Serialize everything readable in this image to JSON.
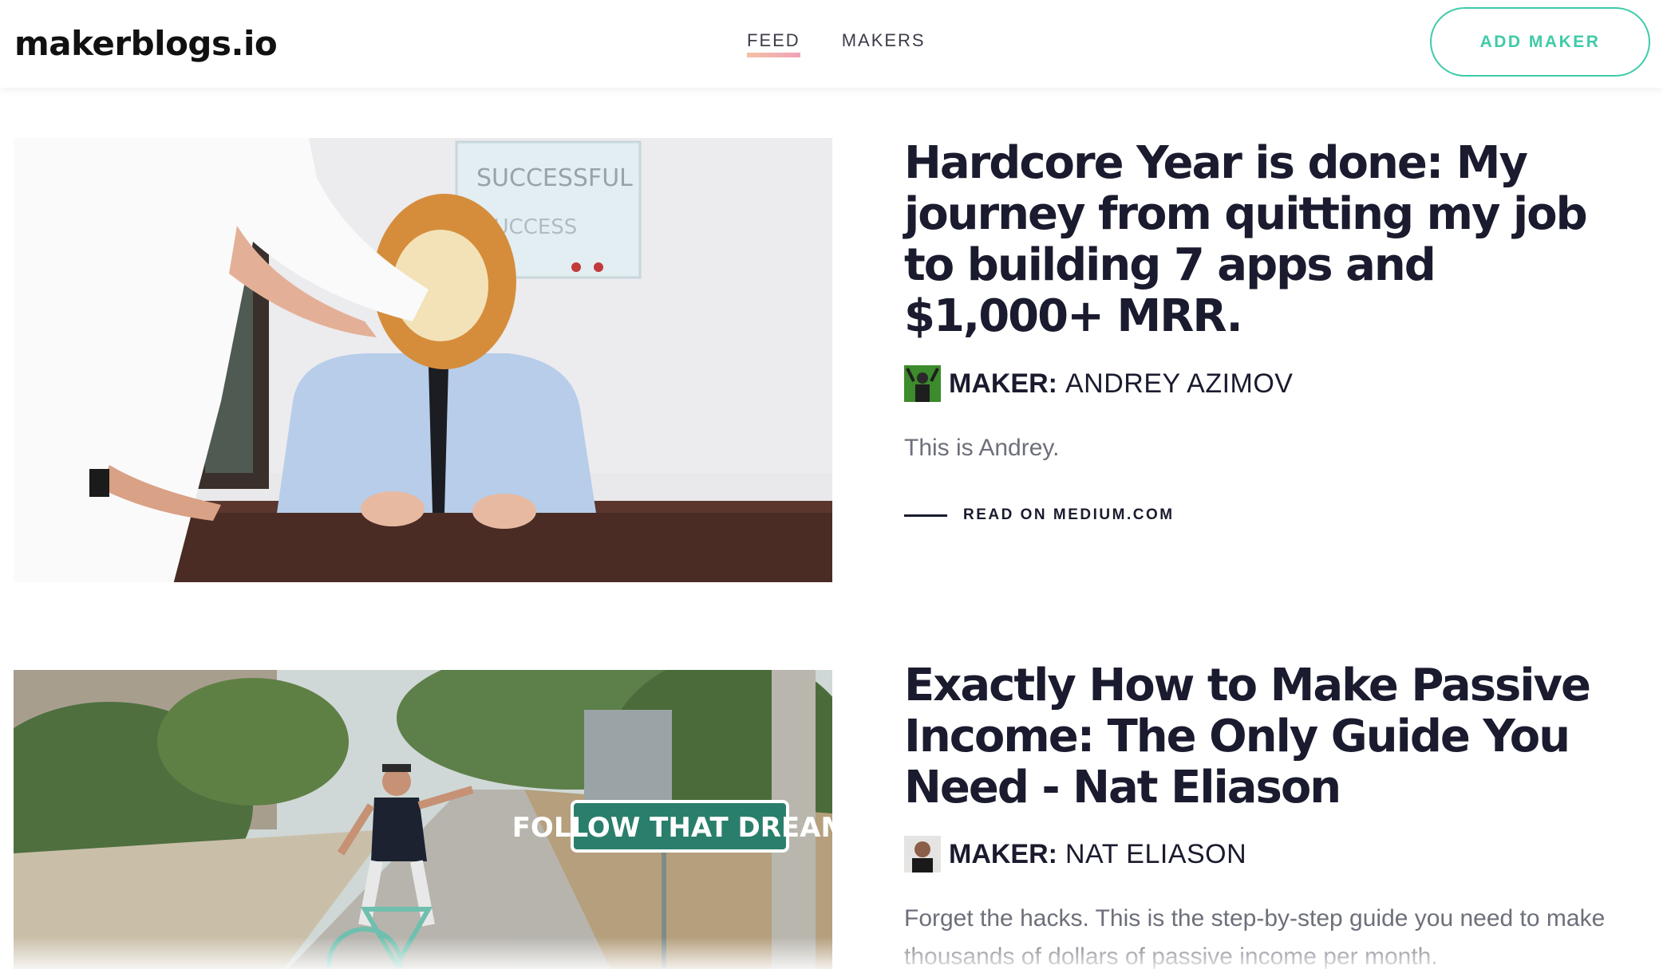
{
  "header": {
    "logo": "makerblogs.io",
    "nav": [
      {
        "label": "FEED",
        "active": true
      },
      {
        "label": "MAKERS",
        "active": false
      }
    ],
    "add_button": "ADD MAKER"
  },
  "colors": {
    "accent": "#3ecba8",
    "text_dark": "#1a1b2e",
    "muted": "#6d6f7a",
    "nav_underline": "#f0a2b8"
  },
  "posts": [
    {
      "title": "Hardcore Year is done: My journey from quitting my job to building 7 apps and $1,000+ MRR.",
      "maker_label": "MAKER:",
      "maker_name": "ANDREY AZIMOV",
      "description": "This is Andrey.",
      "read_link": "READ ON MEDIUM.COM",
      "image_icon": "cake-in-face-photo"
    },
    {
      "title": "Exactly How to Make Passive Income: The Only Guide You Need - Nat Eliason",
      "maker_label": "MAKER:",
      "maker_name": "NAT ELIASON",
      "description": "Forget the hacks. This is the step-by-step guide you need to make thousands of dollars of passive income per month.",
      "image_sign_text": "FOLLOW THAT DREAM",
      "image_icon": "bicycle-street-photo"
    }
  ]
}
